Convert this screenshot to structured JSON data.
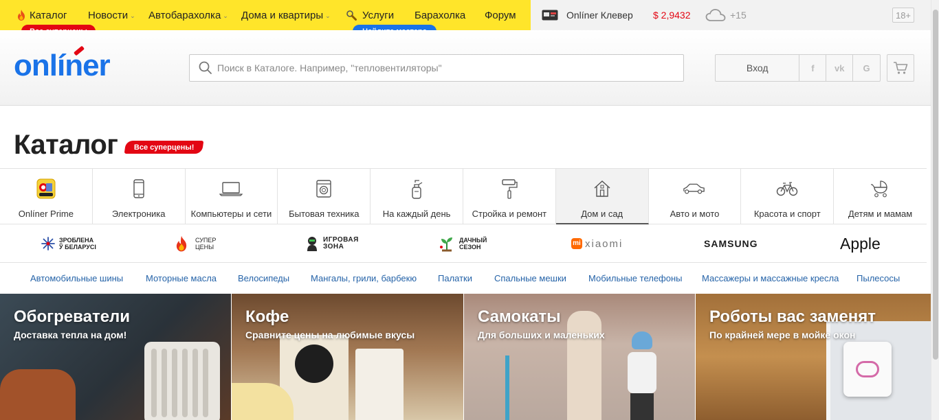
{
  "topbar": {
    "nav": [
      {
        "label": "Каталог",
        "icon": "fire-icon"
      },
      {
        "label": "Новости",
        "dropdown": true
      },
      {
        "label": "Автобарахолка",
        "dropdown": true
      },
      {
        "label": "Дома и квартиры",
        "dropdown": true
      },
      {
        "label": "Услуги",
        "icon": "wrench-icon"
      },
      {
        "label": "Барахолка"
      },
      {
        "label": "Форум"
      }
    ],
    "catalog_badge": "Все суперцены",
    "services_badge": "Найдите мастера",
    "clever": "Onlíner Клевер",
    "currency": "$ 2,9432",
    "weather": "+15",
    "age": "18+"
  },
  "header": {
    "logo": "onlíner",
    "search_placeholder": "Поиск в Каталоге. Например, \"тепловентиляторы\"",
    "login": "Вход",
    "social": [
      "f",
      "vk",
      "G"
    ]
  },
  "page": {
    "title": "Каталог",
    "badge": "Все суперцены!"
  },
  "categories": [
    {
      "label": "Onlíner Prime",
      "icon": "prime-icon"
    },
    {
      "label": "Электроника",
      "icon": "phone-icon"
    },
    {
      "label": "Компьютеры и сети",
      "icon": "laptop-icon"
    },
    {
      "label": "Бытовая техника",
      "icon": "washer-icon"
    },
    {
      "label": "На каждый день",
      "icon": "spray-icon"
    },
    {
      "label": "Стройка и ремонт",
      "icon": "roller-icon"
    },
    {
      "label": "Дом и сад",
      "icon": "house-icon"
    },
    {
      "label": "Авто и мото",
      "icon": "car-icon"
    },
    {
      "label": "Красота и спорт",
      "icon": "bicycle-icon"
    },
    {
      "label": "Детям и мамам",
      "icon": "stroller-icon"
    }
  ],
  "brands": {
    "belarus": [
      "ЗРОБЛЕНА",
      "Ў БЕЛАРУСІ"
    ],
    "superprice": [
      "СУПЕР",
      "ЦЕНЫ"
    ],
    "gaming": [
      "ИГРОВАЯ",
      "ЗОНА"
    ],
    "dacha": [
      "ДАЧНЫЙ",
      "СЕЗОН"
    ],
    "xiaomi": "xiaomi",
    "samsung": "SAMSUNG",
    "apple": "Apple"
  },
  "quick_links": [
    "Автомобильные шины",
    "Моторные масла",
    "Велосипеды",
    "Мангалы, грили, барбекю",
    "Палатки",
    "Спальные мешки",
    "Мобильные телефоны",
    "Массажеры и массажные кресла",
    "Пылесосы"
  ],
  "promos": [
    {
      "title": "Обогреватели",
      "subtitle": "Доставка тепла на дом!"
    },
    {
      "title": "Кофе",
      "subtitle": "Сравните цены на любимые вкусы"
    },
    {
      "title": "Самокаты",
      "subtitle": "Для больших и маленьких"
    },
    {
      "title": "Роботы вас заменят",
      "subtitle": "По крайней мере в мойке окон"
    }
  ],
  "colors": {
    "accent": "#1a73e8",
    "red": "#e30613",
    "yellow": "#ffe52a"
  }
}
